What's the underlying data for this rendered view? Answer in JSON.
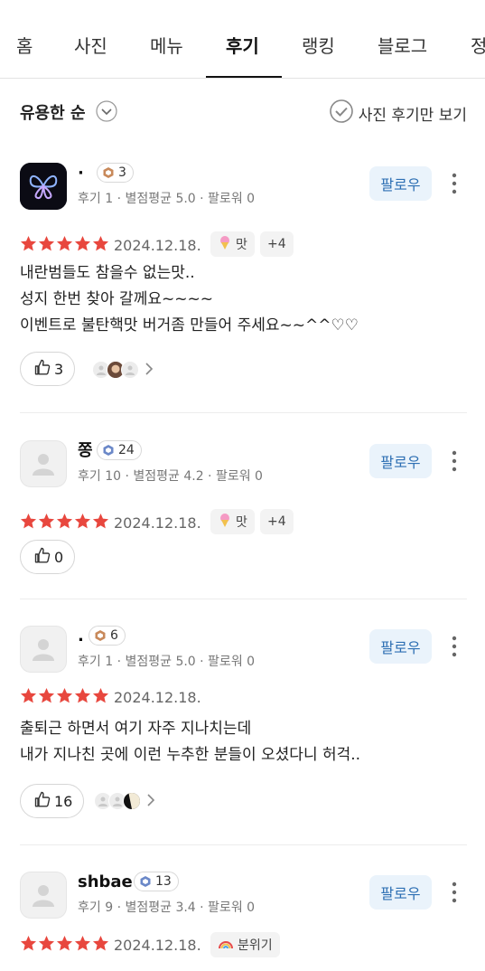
{
  "tabs": [
    "홈",
    "사진",
    "메뉴",
    "후기",
    "랭킹",
    "블로그",
    "정"
  ],
  "active_tab": "후기",
  "sort": {
    "label": "유용한 순",
    "photo_only": "사진 후기만 보기"
  },
  "follow_label": "팔로우",
  "reviews": [
    {
      "name": "·",
      "badge": "3",
      "meta": "후기 1 · 별점평균 5.0 · 팔로워 0",
      "date": "2024.12.18.",
      "tag": "맛",
      "tag_more": "+4",
      "text": "내란범들도 참을수 없는맛..\n성지 한번 찾아 갈께요~~~~\n이벤트로 불탄핵맛 버거좀 만들어 주세요~~^^♡♡",
      "likes": "3",
      "rating": 5
    },
    {
      "name": "쫑",
      "badge": "24",
      "meta": "후기 10 · 별점평균 4.2 · 팔로워 0",
      "date": "2024.12.18.",
      "tag": "맛",
      "tag_more": "+4",
      "text": "",
      "likes": "0",
      "rating": 5
    },
    {
      "name": ".",
      "badge": "6",
      "meta": "후기 1 · 별점평균 5.0 · 팔로워 0",
      "date": "2024.12.18.",
      "text": "출퇴근 하면서 여기 자주 지나치는데\n내가 지나친 곳에 이런 누추한 분들이 오셨다니 허걱..",
      "likes": "16",
      "rating": 5
    },
    {
      "name": "shbae",
      "badge": "13",
      "meta": "후기 9 · 별점평균 3.4 · 팔로워 0",
      "date": "2024.12.18.",
      "tag": "분위기",
      "rating": 5
    }
  ],
  "colors": {
    "star": "#e8473e",
    "follow_bg": "#eaf3fb",
    "follow_text": "#2d6fb3"
  }
}
